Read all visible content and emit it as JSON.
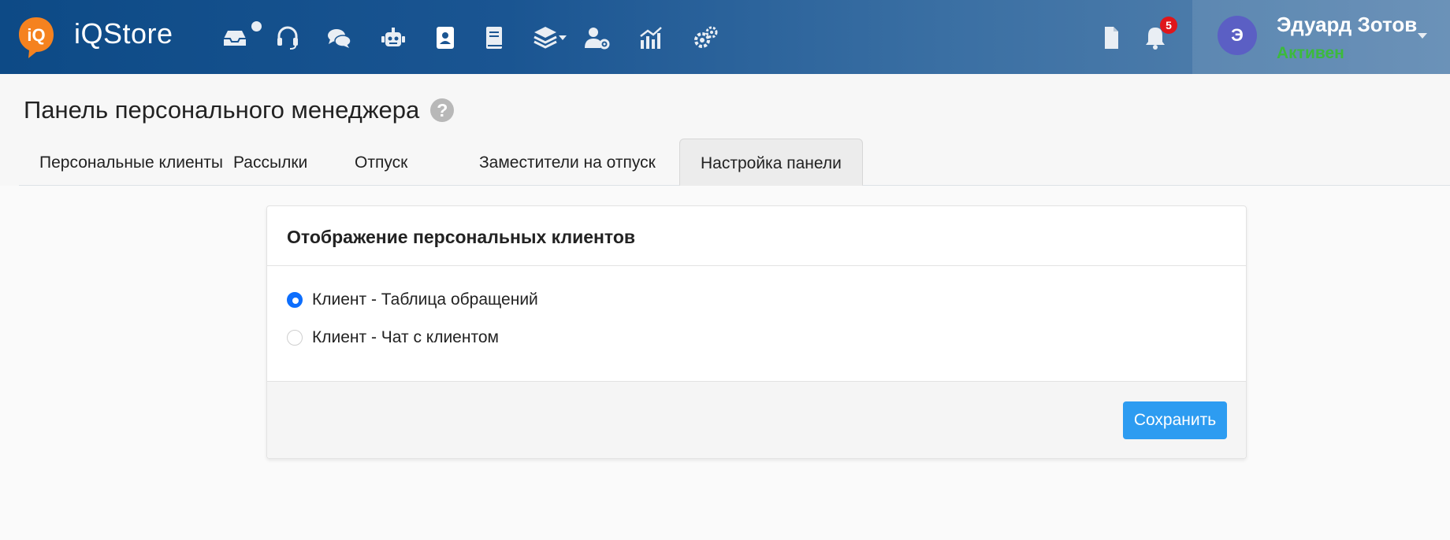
{
  "app": {
    "brand": "iQStore",
    "logo_text": "iQ"
  },
  "topnav": {
    "icons": [
      "inbox-icon",
      "headset-icon",
      "chat-icon",
      "robot-icon",
      "contact-card-icon",
      "book-icon",
      "layers-icon",
      "user-settings-icon",
      "analytics-icon",
      "settings-icon"
    ],
    "notifications_count": "5",
    "user": {
      "initial": "Э",
      "name": "Эдуард Зотов",
      "status": "Активен"
    }
  },
  "page": {
    "title": "Панель персонального менеджера",
    "help": "?"
  },
  "tabs": [
    {
      "label": "Персональные клиенты",
      "active": false
    },
    {
      "label": "Рассылки",
      "active": false
    },
    {
      "label": "Отпуск",
      "active": false
    },
    {
      "label": "Заместители на отпуск",
      "active": false
    },
    {
      "label": "Настройка панели",
      "active": true
    }
  ],
  "card": {
    "title": "Отображение персональных клиентов",
    "options": [
      {
        "label": "Клиент - Таблица обращений",
        "checked": true
      },
      {
        "label": "Клиент - Чат с клиентом",
        "checked": false
      }
    ],
    "save_label": "Сохранить"
  },
  "colors": {
    "accent": "#0d6efd",
    "button": "#2d9cf1",
    "status_active": "#3cba3c",
    "badge": "#e0161b",
    "avatar": "#5b5fc4"
  }
}
